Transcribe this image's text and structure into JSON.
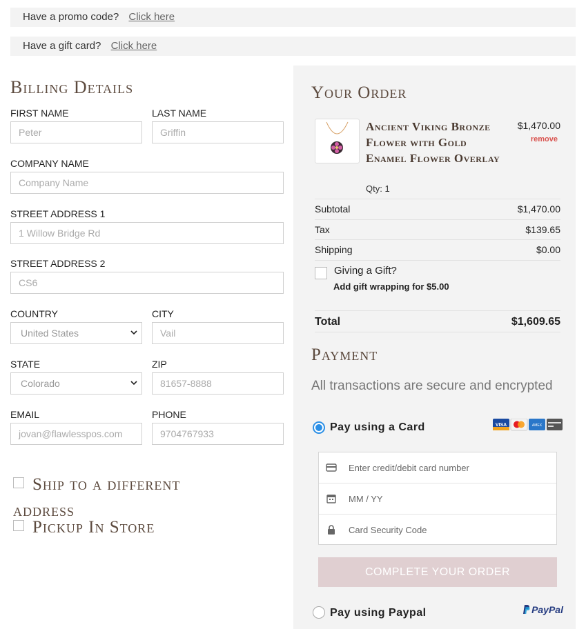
{
  "promo": {
    "question": "Have a promo code?",
    "link": "Click here"
  },
  "giftcard": {
    "question": "Have a gift card?",
    "link": "Click here"
  },
  "billing": {
    "title": "Billing Details",
    "first_name": {
      "label": "FIRST NAME",
      "value": "Peter"
    },
    "last_name": {
      "label": "LAST NAME",
      "value": "Griffin"
    },
    "company": {
      "label": "COMPANY NAME",
      "placeholder": "Company Name"
    },
    "street1": {
      "label": "STREET ADDRESS 1",
      "value": "1 Willow Bridge Rd"
    },
    "street2": {
      "label": "STREET ADDRESS 2",
      "value": "CS6"
    },
    "country": {
      "label": "COUNTRY",
      "value": "United States"
    },
    "city": {
      "label": "CITY",
      "value": "Vail"
    },
    "state": {
      "label": "STATE",
      "value": "Colorado"
    },
    "zip": {
      "label": "ZIP",
      "value": "81657-8888"
    },
    "email": {
      "label": "EMAIL",
      "value": "jovan@flawlesspos.com"
    },
    "phone": {
      "label": "PHONE",
      "value": "9704767933"
    },
    "ship_different": "Ship to a different address",
    "pickup": "Pickup In Store"
  },
  "order": {
    "title": "Your Order",
    "product": {
      "name": "Ancient Viking Bronze Flower with Gold Enamel Flower Overlay",
      "qty": "Qty: 1",
      "price": "$1,470.00",
      "remove": "remove"
    },
    "subtotal": {
      "label": "Subtotal",
      "value": "$1,470.00"
    },
    "tax": {
      "label": "Tax",
      "value": "$139.65"
    },
    "shipping": {
      "label": "Shipping",
      "value": "$0.00"
    },
    "gift": {
      "question": "Giving a Gift?",
      "sub": "Add gift wrapping for $5.00"
    },
    "total": {
      "label": "Total",
      "value": "$1,609.65"
    }
  },
  "payment": {
    "title": "Payment",
    "secure": "All transactions are secure and encrypted",
    "card_option": "Pay using a Card",
    "card_number_placeholder": "Enter credit/debit card number",
    "expiry_placeholder": "MM / YY",
    "cvc_placeholder": "Card Security Code",
    "complete_button": "COMPLETE YOUR ORDER",
    "paypal_option": "Pay using Paypal",
    "paypal_logo": "PayPal",
    "card_brands": [
      "VISA",
      "Mastercard",
      "American Express",
      "Card"
    ]
  },
  "colors": {
    "heading": "#5c4a3e",
    "radio_selected": "#2b8fe6",
    "button": "#e0cfd1",
    "remove": "#d9534f",
    "panel": "#f3f3f3"
  }
}
